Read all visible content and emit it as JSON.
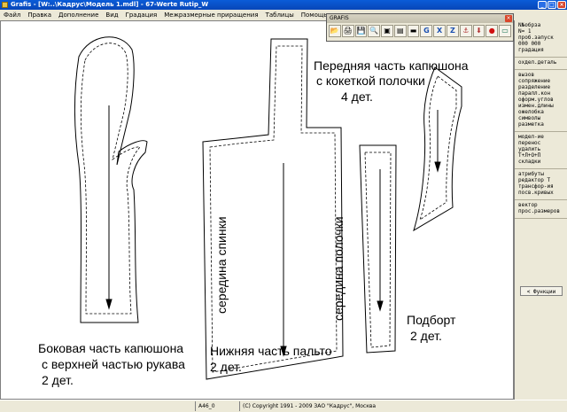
{
  "window": {
    "title": "Grafis - [W:..\\Кадрус\\Модель 1.mdl] - 67-Werte Rutip_W"
  },
  "menu": [
    "Файл",
    "Правка",
    "Дополнение",
    "Вид",
    "Градация",
    "Межразмерные приращения",
    "Таблицы",
    "Помощь"
  ],
  "toolbar": {
    "title": "GRAFIS",
    "tools": [
      "open-folder-icon",
      "print-icon",
      "save-icon",
      "zoom-icon",
      "page-icon",
      "layers-icon",
      "ruler-icon",
      "g-icon",
      "x-tool-icon",
      "z-tool-icon",
      "anchor-icon",
      "arrow-down-icon",
      "stop-icon",
      "screen-icon"
    ]
  },
  "canvas": {
    "labels": {
      "front_hood": [
        "Передняя часть капюшона",
        "с кокеткой полочки",
        "4 дет."
      ],
      "side_hood": [
        "Боковая часть капюшона",
        "с верхней частью рукава",
        "2 дет."
      ],
      "lower_coat": [
        "Нижняя часть пальто",
        "2 дет."
      ],
      "facing": [
        "Подборт",
        "2 дет."
      ],
      "back_middle": "середина спинки",
      "front_middle": "середина полочки"
    }
  },
  "right_panel": {
    "group1": [
      "N№обрза",
      "N=   1",
      "проб.запуск",
      "000 000",
      "градация"
    ],
    "group2": [
      "охдел.деталь"
    ],
    "group3": [
      "вызов",
      "сопряжение",
      "разделение",
      "паралл.кон",
      "оформ.углов",
      "измен.длины",
      "ожелобка",
      "символы",
      "разметка"
    ],
    "group4": [
      "модел-ие",
      "перенос",
      "удалить",
      "Т+Л+О+П",
      "складки"
    ],
    "group5": [
      "атрибуты",
      "редактор Т",
      "трансфор-ия",
      "посв.кривых"
    ],
    "group6": [
      "вектор",
      "прос.размеров"
    ],
    "button": "< Функции"
  },
  "statusbar": {
    "cell1": "A46_0",
    "copyright": "(C) Copyright 1991 - 2009 ЗАО \"Кадрус\", Москва"
  }
}
